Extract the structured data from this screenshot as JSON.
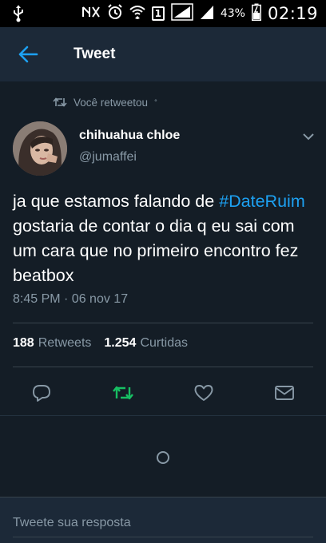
{
  "status_bar": {
    "battery_percent": "43%",
    "time": "02:19",
    "sim_slot": "1"
  },
  "header": {
    "title": "Tweet"
  },
  "retweet_context": {
    "label": "Você retweetou"
  },
  "tweet": {
    "author_name": "chihuahua chloe",
    "author_handle": "@jumaffei",
    "text_before": "ja que estamos falando de ",
    "hashtag": "#DateRuim",
    "text_after": " gostaria de contar o dia q  eu sai com um cara que no primeiro encontro fez beatbox",
    "timestamp": "8:45 PM · 06 nov 17"
  },
  "stats": {
    "retweets_count": "188",
    "retweets_label": "Retweets",
    "likes_count": "1.254",
    "likes_label": "Curtidas"
  },
  "actions": {
    "reply_icon": "reply-icon",
    "retweet_icon": "retweet-icon",
    "like_icon": "heart-icon",
    "message_icon": "mail-icon",
    "retweet_active_color": "#17bf63"
  },
  "reply": {
    "placeholder": "Tweete sua resposta"
  },
  "colors": {
    "background": "#141d26",
    "header": "#1c2938",
    "accent": "#1da1f2",
    "muted": "#8899a6"
  }
}
